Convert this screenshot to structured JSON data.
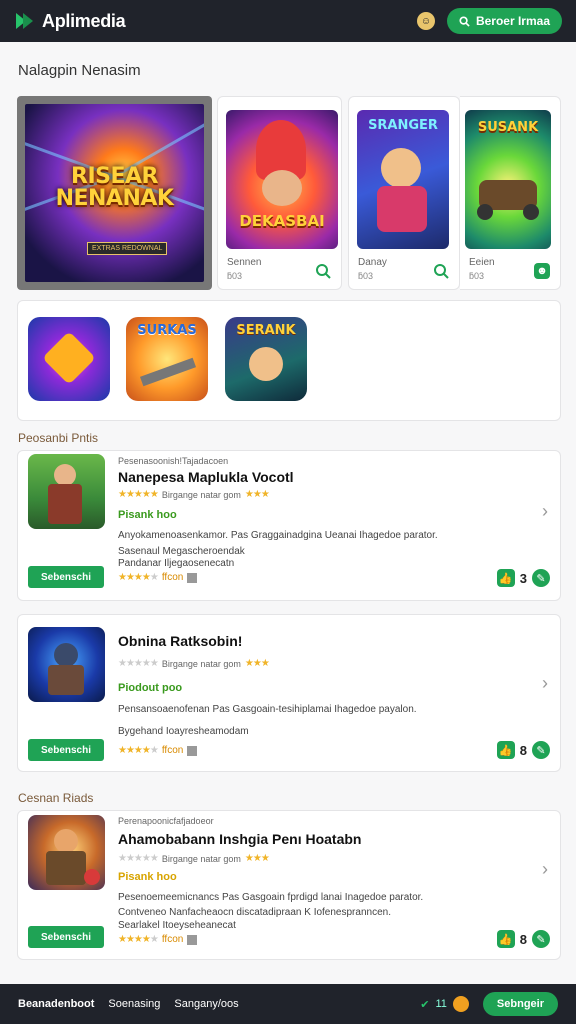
{
  "header": {
    "logo_text": "Aplimedia",
    "search_label": "Beroer Irmaa",
    "brand_color": "#1fa355"
  },
  "featured": {
    "section_title": "Nalagpin Nenasim",
    "main": {
      "title_line1": "RISEAR",
      "title_line2": "NENANAK",
      "badge": "EXTRAS REDOWNAL"
    },
    "cards": [
      {
        "art_title": "DEKASBAI",
        "name": "Sennen",
        "sub": "ƃ03",
        "icon": "search-icon"
      },
      {
        "art_title": "SRANGER",
        "name": "Danay",
        "sub": "ƃ03",
        "icon": "search-icon"
      },
      {
        "art_title": "SUSANK",
        "name": "Eeien",
        "sub": "ƃ03",
        "icon": "user-icon"
      }
    ]
  },
  "icon_row": {
    "items": [
      {
        "label": ""
      },
      {
        "label": "SURKAS"
      },
      {
        "label": "SERANK"
      }
    ]
  },
  "lists": {
    "section1_title": "Peosanbi Pntis",
    "section2_title": "Cesnan Riads",
    "items": [
      {
        "meta": "Pesenasoonish!Tajadacoen",
        "title": "Nanepesa Maplukla Vocotl",
        "rating_text": "Birgange natar gom",
        "tag": "Pisank hoo",
        "tag_color": "#3a9a1e",
        "desc1": "Anyokamenoasenkamor. Pas Graggainadgina Ueanai Ihagedoe parator.",
        "desc2": "Sasenaul Megascheroendak",
        "desc3": "Pandanar Iljegaosenecatn",
        "button": "Sebenschi",
        "bottom_rating": "ffcon",
        "count": "3"
      },
      {
        "meta": "",
        "title": "Obnina Ratksobin!",
        "rating_text": "Birgange natar gom",
        "tag": "Piodout poo",
        "tag_color": "#3a9a1e",
        "desc1": "Pensansoaenofenan Pas Gasgoain-tesihiplamai Ihagedoe payalon.",
        "desc2": "Bygehand Ioayresheamodam",
        "desc3": "",
        "button": "Sebenschi",
        "bottom_rating": "ffcon",
        "count": "8"
      },
      {
        "meta": "Perenapoonicfafjadoeor",
        "title": "Ahamobabann Inshgia Penı Hoatabn",
        "rating_text": "Birgange natar gom",
        "tag": "Pisank hoo",
        "tag_color": "#d8a400",
        "desc1": "Pesenoemeemicnancs Pas Gasgoain fprdigd lanai Inagedoe parator.",
        "desc2": "Contveneo Nanfacheaocn discatadipraan K Iofenespranncen.",
        "desc3": "Searlakel Itoeyseheanecat",
        "button": "Sebenschi",
        "bottom_rating": "ffcon",
        "count": "8"
      }
    ]
  },
  "footer": {
    "link1": "Beanadenboot",
    "link2": "Soenasing",
    "link3": "Sangany/oos",
    "count": "11",
    "button": "Sebngeir"
  }
}
